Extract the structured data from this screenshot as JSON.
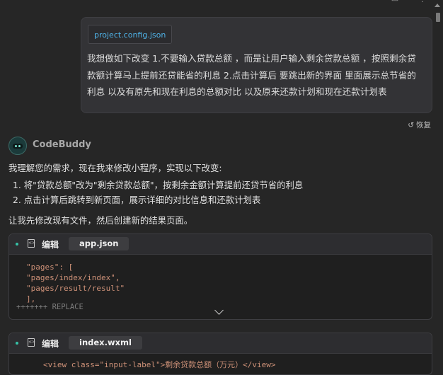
{
  "top_icons": [
    "panel-icon",
    "more-icon"
  ],
  "user_message": {
    "file_chip": "project.config.json",
    "lines": [
      "我想做如下改变 1.不要输入贷款总额 ，而是让用户输入剩余贷款总额 ，按照剩余贷",
      "款额计算马上提前还贷能省的利息 2.点击计算后 要跳出新的界面 里面展示总节省的",
      "利息 以及有原先和现在利息的总额对比 以及原来还款计划和现在还款计划表"
    ]
  },
  "restore_label": "恢复",
  "assistant": {
    "name": "CodeBuddy",
    "intro": "我理解您的需求，现在我来修改小程序，实现以下改变:",
    "list": [
      "1. 将\"贷款总额\"改为\"剩余贷款总额\"，按剩余金额计算提前还贷节省的利息",
      "2. 点击计算后跳转到新页面，展示详细的对比信息和还款计划表"
    ],
    "followup": "让我先修改现有文件，然后创建新的结果页面。"
  },
  "cards": [
    {
      "action": "编辑",
      "filename": "app.json",
      "code_lines": [
        "\"pages\": [",
        "  \"pages/index/index\",",
        "  \"pages/result/result\"",
        "],"
      ],
      "replace_label": "+++++++ REPLACE"
    },
    {
      "action": "编辑",
      "filename": "index.wxml",
      "code_lines": [
        "<view class=\"input-label\">剩余贷款总额（万元）</view>"
      ]
    }
  ]
}
